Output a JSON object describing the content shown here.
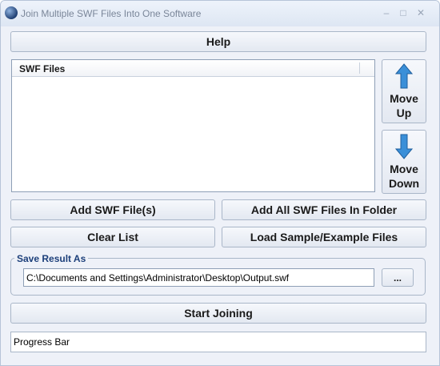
{
  "window": {
    "title": "Join Multiple SWF Files Into One Software",
    "minimize_label": "–",
    "maximize_label": "□",
    "close_label": "✕"
  },
  "toolbar": {
    "help_label": "Help"
  },
  "file_list": {
    "column_header": "SWF Files",
    "items": []
  },
  "move_up": {
    "line1": "Move",
    "line2": "Up"
  },
  "move_down": {
    "line1": "Move",
    "line2": "Down"
  },
  "actions": {
    "add_files_label": "Add SWF File(s)",
    "add_folder_label": "Add All SWF Files In Folder",
    "clear_list_label": "Clear List",
    "load_sample_label": "Load Sample/Example Files"
  },
  "save_result": {
    "group_label": "Save Result As",
    "path_value": "C:\\Documents and Settings\\Administrator\\Desktop\\Output.swf",
    "browse_label": "..."
  },
  "start_label": "Start Joining",
  "progress": {
    "label": "Progress Bar"
  },
  "colors": {
    "arrow_blue": "#3a8fd8",
    "group_label": "#1c3f7a"
  }
}
